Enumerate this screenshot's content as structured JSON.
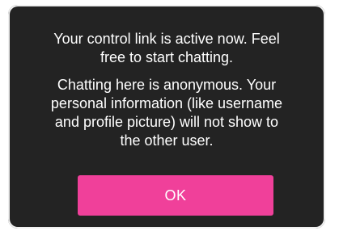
{
  "dialog": {
    "message_1": [
      "Your control link is active now. Feel",
      "free to start chatting."
    ],
    "message_2": [
      "Chatting here is anonymous. Your",
      "personal information (like username",
      "and profile picture) will not show to",
      "the other user."
    ],
    "ok_label": "OK"
  },
  "colors": {
    "dialog_background": "#232323",
    "button_accent": "#f0409a",
    "text": "#ffffff"
  }
}
